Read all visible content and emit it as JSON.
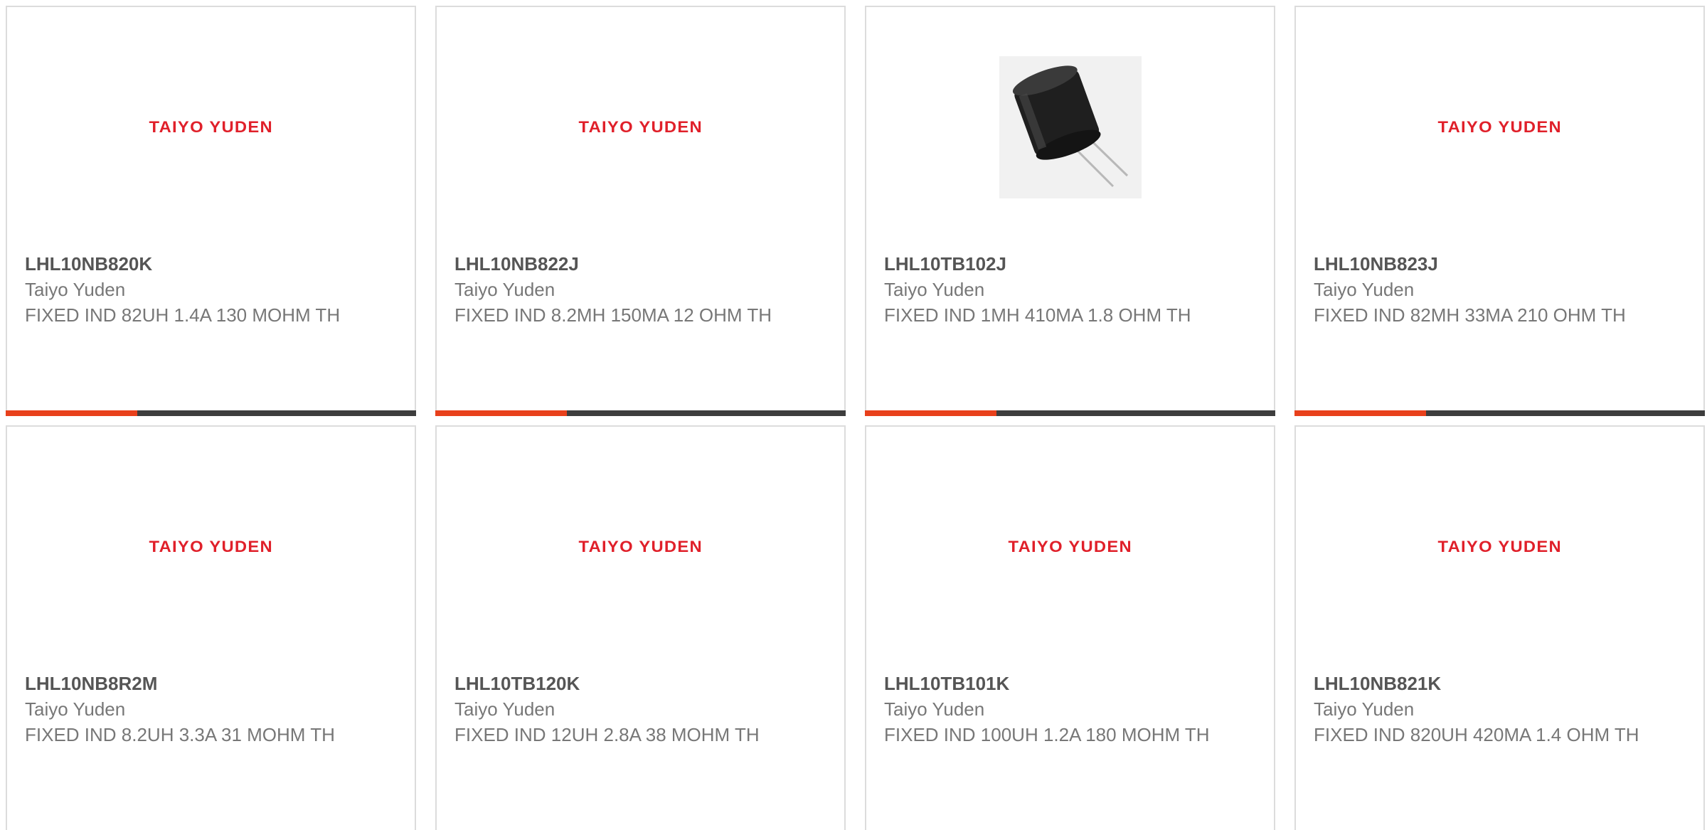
{
  "products": [
    {
      "part": "LHL10NB820K",
      "manufacturer": "Taiyo Yuden",
      "description": "FIXED IND 82UH 1.4A 130 MOHM TH",
      "image": "logo",
      "logo_text": "TAIYO YUDEN"
    },
    {
      "part": "LHL10NB822J",
      "manufacturer": "Taiyo Yuden",
      "description": "FIXED IND 8.2MH 150MA 12 OHM TH",
      "image": "logo",
      "logo_text": "TAIYO YUDEN"
    },
    {
      "part": "LHL10TB102J",
      "manufacturer": "Taiyo Yuden",
      "description": "FIXED IND 1MH 410MA 1.8 OHM TH",
      "image": "photo",
      "logo_text": ""
    },
    {
      "part": "LHL10NB823J",
      "manufacturer": "Taiyo Yuden",
      "description": "FIXED IND 82MH 33MA 210 OHM TH",
      "image": "logo",
      "logo_text": "TAIYO YUDEN"
    },
    {
      "part": "LHL10NB8R2M",
      "manufacturer": "Taiyo Yuden",
      "description": "FIXED IND 8.2UH 3.3A 31 MOHM TH",
      "image": "logo",
      "logo_text": "TAIYO YUDEN"
    },
    {
      "part": "LHL10TB120K",
      "manufacturer": "Taiyo Yuden",
      "description": "FIXED IND 12UH 2.8A 38 MOHM TH",
      "image": "logo",
      "logo_text": "TAIYO YUDEN"
    },
    {
      "part": "LHL10TB101K",
      "manufacturer": "Taiyo Yuden",
      "description": "FIXED IND 100UH 1.2A 180 MOHM TH",
      "image": "logo",
      "logo_text": "TAIYO YUDEN"
    },
    {
      "part": "LHL10NB821K",
      "manufacturer": "Taiyo Yuden",
      "description": "FIXED IND 820UH 420MA 1.4 OHM TH",
      "image": "logo",
      "logo_text": "TAIYO YUDEN"
    }
  ],
  "colors": {
    "logo": "#e0202a",
    "accent_bar": "#e8401b",
    "dark_bar": "#3d3d3d",
    "card_border": "#dcdcdc"
  }
}
